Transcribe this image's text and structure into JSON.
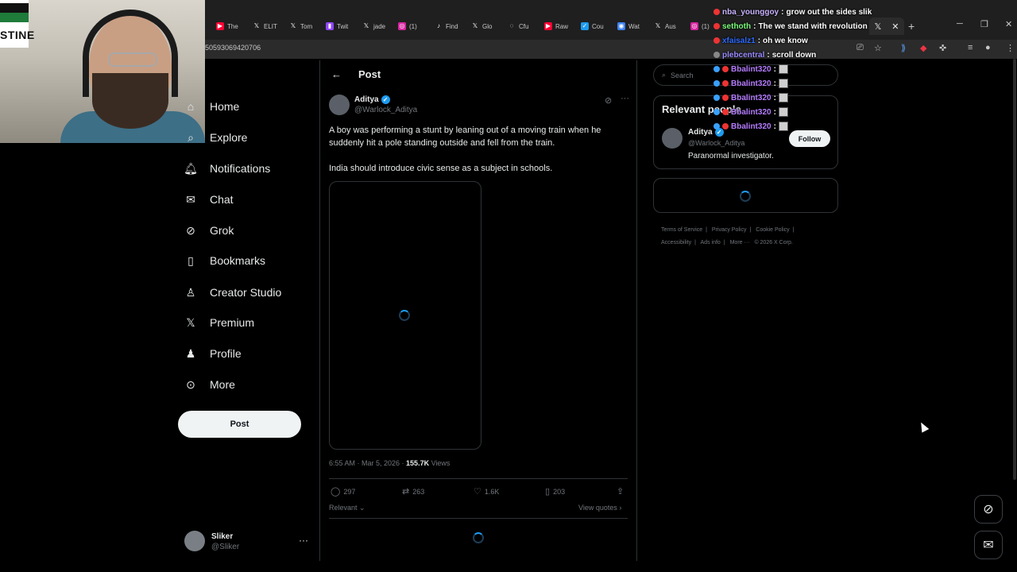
{
  "browser": {
    "tabs": [
      "The",
      "ELIT",
      "Tom",
      "Twit",
      "jade",
      "(1)",
      "Find",
      "Glo",
      "Cfu",
      "Raw",
      "Cou",
      "Wat",
      "Aus",
      "(1)"
    ],
    "url": "50593069420706"
  },
  "sidebar": {
    "items": [
      {
        "label": "Home",
        "icon": "home-icon"
      },
      {
        "label": "Explore",
        "icon": "search-icon"
      },
      {
        "label": "Notifications",
        "icon": "bell-icon"
      },
      {
        "label": "Chat",
        "icon": "mail-icon"
      },
      {
        "label": "Grok",
        "icon": "grok-icon"
      },
      {
        "label": "Bookmarks",
        "icon": "bookmark-icon"
      },
      {
        "label": "Creator Studio",
        "icon": "creator-icon"
      },
      {
        "label": "Premium",
        "icon": "x-logo-icon"
      },
      {
        "label": "Profile",
        "icon": "person-icon"
      },
      {
        "label": "More",
        "icon": "more-circle-icon"
      }
    ],
    "post_button": "Post",
    "account": {
      "name": "Sliker",
      "handle": "@Sliker"
    }
  },
  "main": {
    "header_title": "Post",
    "tweet": {
      "author": "Aditya",
      "handle": "@Warlock_Aditya",
      "text_1": "A boy was performing a stunt by leaning out of a moving train when he suddenly hit a pole standing outside and fell from the train.",
      "text_2": "India should introduce civic sense as a subject in schools.",
      "timestamp": "6:55 AM · Mar 5, 2026 · ",
      "views": "155.7K",
      "views_label": " Views",
      "replies": "297",
      "reposts": "263",
      "likes": "1.6K",
      "bookmarks": "203"
    },
    "sort_label": "Relevant",
    "view_quotes": "View quotes"
  },
  "right": {
    "search_placeholder": "Search",
    "relevant_title": "Relevant people",
    "person": {
      "name": "Aditya",
      "handle": "@Warlock_Aditya",
      "bio": "Paranormal investigator.",
      "follow_label": "Follow"
    },
    "footer": [
      "Terms of Service",
      "|",
      "Privacy Policy",
      "|",
      "Cookie Policy",
      "|",
      "Accessibility",
      "|",
      "Ads info",
      "|",
      "More ···",
      "© 2026 X Corp."
    ]
  },
  "chat": [
    {
      "user": "nba_younggoy",
      "msg": "grow out the sides slik",
      "color": "#c9b3ff"
    },
    {
      "user": "sethoth",
      "msg": "The we stand with revolution",
      "color": "#7cfc7c"
    },
    {
      "user": "xfaisalz1",
      "msg": "oh we know",
      "color": "#2e6bff"
    },
    {
      "user": "plebcentral",
      "msg": "scroll down",
      "color": "#9b8cff"
    },
    {
      "user": "Bbalint320",
      "msg": "",
      "color": "#b57cff"
    },
    {
      "user": "Bbalint320",
      "msg": "",
      "color": "#b57cff"
    },
    {
      "user": "Bbalint320",
      "msg": "",
      "color": "#b57cff"
    },
    {
      "user": "Bbalint320",
      "msg": "",
      "color": "#b57cff"
    },
    {
      "user": "Bbalint320",
      "msg": "",
      "color": "#b57cff"
    }
  ],
  "webcam": {
    "flag_text": "STINE"
  },
  "colors": {
    "accent": "#1d9bf0",
    "background": "#000000",
    "border": "#2f3336",
    "muted": "#71767b"
  }
}
